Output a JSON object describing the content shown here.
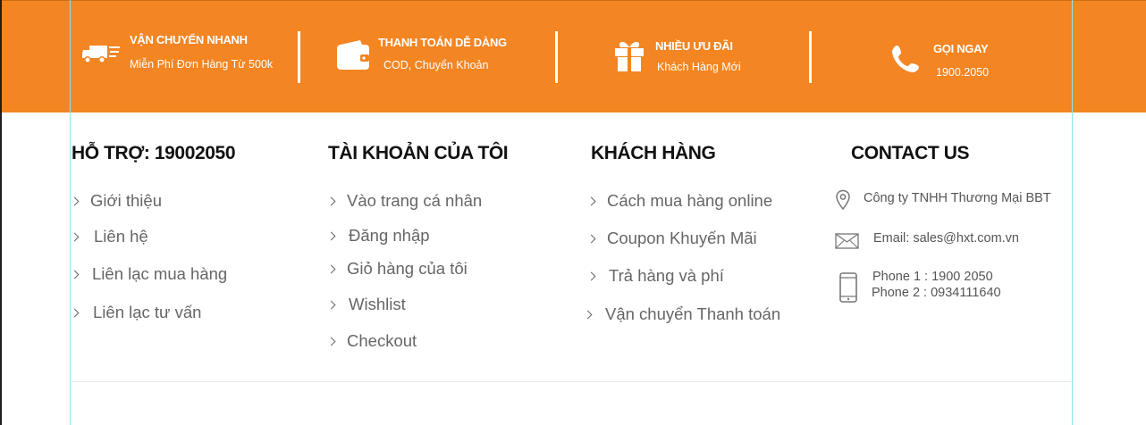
{
  "features": [
    {
      "icon": "truck-icon",
      "title": "VẬN CHUYỂN NHANH",
      "subtitle": "Miễn Phí Đơn Hàng Từ 500k"
    },
    {
      "icon": "wallet-icon",
      "title": "THANH TOÁN DỄ DÀNG",
      "subtitle": "COD, Chuyển Khoản"
    },
    {
      "icon": "gift-icon",
      "title": "NHIỀU ƯU ĐÃI",
      "subtitle": "Khách Hàng Mới"
    },
    {
      "icon": "phone-icon",
      "title": "GỌI NGAY",
      "subtitle": "1900.2050"
    }
  ],
  "support": {
    "title": "HỖ TRỢ: 19002050",
    "links": [
      "Giới thiệu",
      "Liên hệ",
      "Liên lạc mua hàng",
      "Liên lạc tư vấn"
    ]
  },
  "account": {
    "title": "TÀI KHOẢN CỦA TÔI",
    "links": [
      "Vào trang cá nhân",
      "Đăng nhập",
      "Giỏ hàng của tôi",
      "Wishlist",
      "Checkout"
    ]
  },
  "customer": {
    "title": "KHÁCH HÀNG",
    "links": [
      "Cách mua hàng online",
      "Coupon Khuyến Mãi",
      "Trả hàng và phí",
      "Vận chuyển Thanh toán"
    ]
  },
  "contact": {
    "title": "CONTACT US",
    "company": "Công ty TNHH Thương Mại BBT",
    "email": "Email: sales@hxt.com.vn",
    "phone1": "Phone 1 : 1900 2050",
    "phone2": "Phone 2 : 0934111640"
  },
  "colors": {
    "accent": "#f38523",
    "text": "#666666",
    "heading": "#111111"
  }
}
